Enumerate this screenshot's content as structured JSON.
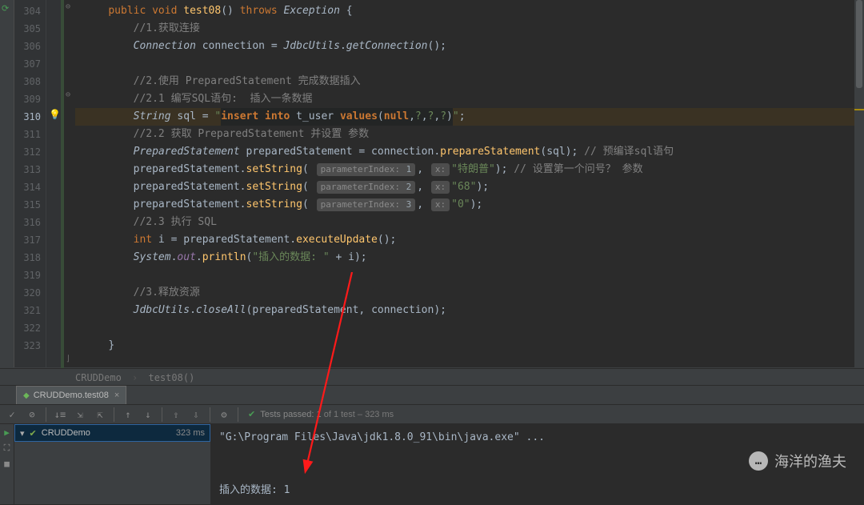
{
  "editor": {
    "first_line_number": 304,
    "highlighted_line": 310,
    "code_lines": [
      {
        "n": 304,
        "tokens": [
          [
            "kw",
            "public"
          ],
          [
            "p",
            " "
          ],
          [
            "kw",
            "void"
          ],
          [
            "p",
            " "
          ],
          [
            "method",
            "test08"
          ],
          [
            "p",
            "() "
          ],
          [
            "kw",
            "throws"
          ],
          [
            "p",
            " "
          ],
          [
            "cls",
            "Exception"
          ],
          [
            "p",
            " {"
          ]
        ],
        "indent": 1
      },
      {
        "n": 305,
        "tokens": [
          [
            "comment",
            "//1.获取连接"
          ]
        ],
        "indent": 2
      },
      {
        "n": 306,
        "tokens": [
          [
            "cls",
            "Connection"
          ],
          [
            "p",
            " connection = "
          ],
          [
            "cls",
            "JdbcUtils"
          ],
          [
            "p",
            "."
          ],
          [
            "cls",
            "getConnection"
          ],
          [
            "p",
            "();"
          ]
        ],
        "indent": 2
      },
      {
        "n": 307,
        "tokens": [],
        "indent": 2
      },
      {
        "n": 308,
        "tokens": [
          [
            "comment",
            "//2.使用 PreparedStatement 完成数据插入"
          ]
        ],
        "indent": 2
      },
      {
        "n": 309,
        "tokens": [
          [
            "comment",
            "//2.1 编写SQL语句:  插入一条数据"
          ]
        ],
        "indent": 2
      },
      {
        "n": 310,
        "tokens": [
          [
            "cls",
            "String"
          ],
          [
            "p",
            " sql = "
          ],
          [
            "str",
            "\""
          ],
          [
            "sql-kw",
            "insert"
          ],
          [
            "sql-tok",
            " "
          ],
          [
            "sql-kw",
            "into"
          ],
          [
            "sql-tok",
            " t_user "
          ],
          [
            "sql-kw",
            "values"
          ],
          [
            "sql-tok",
            "("
          ],
          [
            "sql-kw",
            "null"
          ],
          [
            "sql-tok",
            ","
          ],
          [
            "sql-q",
            "?"
          ],
          [
            "sql-tok",
            ","
          ],
          [
            "sql-q",
            "?"
          ],
          [
            "sql-tok",
            ","
          ],
          [
            "sql-q",
            "?"
          ],
          [
            "sql-tok",
            ")"
          ],
          [
            "str",
            "\""
          ],
          [
            "p",
            ";"
          ]
        ],
        "indent": 2
      },
      {
        "n": 311,
        "tokens": [
          [
            "comment",
            "//2.2 获取 PreparedStatement 并设置 参数"
          ]
        ],
        "indent": 2
      },
      {
        "n": 312,
        "tokens": [
          [
            "cls",
            "PreparedStatement"
          ],
          [
            "p",
            " preparedStatement = connection."
          ],
          [
            "method",
            "prepareStatement"
          ],
          [
            "p",
            "(sql); "
          ],
          [
            "comment",
            "// 预编译sql语句"
          ]
        ],
        "indent": 2
      },
      {
        "n": 313,
        "tokens": [
          [
            "p",
            "preparedStatement."
          ],
          [
            "method",
            "setString"
          ],
          [
            "p",
            "( "
          ],
          [
            "hint",
            "parameterIndex:",
            "1"
          ],
          [
            "p",
            ", "
          ],
          [
            "hint",
            "x:",
            ""
          ],
          [
            "str",
            "\"特朗普\""
          ],
          [
            "p",
            "); "
          ],
          [
            "comment",
            "// 设置第一个问号？ 参数"
          ]
        ],
        "indent": 2
      },
      {
        "n": 314,
        "tokens": [
          [
            "p",
            "preparedStatement."
          ],
          [
            "method",
            "setString"
          ],
          [
            "p",
            "( "
          ],
          [
            "hint",
            "parameterIndex:",
            "2"
          ],
          [
            "p",
            ", "
          ],
          [
            "hint",
            "x:",
            ""
          ],
          [
            "str",
            "\"68\""
          ],
          [
            "p",
            ");"
          ]
        ],
        "indent": 2
      },
      {
        "n": 315,
        "tokens": [
          [
            "p",
            "preparedStatement."
          ],
          [
            "method",
            "setString"
          ],
          [
            "p",
            "( "
          ],
          [
            "hint",
            "parameterIndex:",
            "3"
          ],
          [
            "p",
            ", "
          ],
          [
            "hint",
            "x:",
            ""
          ],
          [
            "str",
            "\"0\""
          ],
          [
            "p",
            ");"
          ]
        ],
        "indent": 2
      },
      {
        "n": 316,
        "tokens": [
          [
            "comment",
            "//2.3 执行 SQL"
          ]
        ],
        "indent": 2
      },
      {
        "n": 317,
        "tokens": [
          [
            "kw",
            "int"
          ],
          [
            "p",
            " i = preparedStatement."
          ],
          [
            "method",
            "executeUpdate"
          ],
          [
            "p",
            "();"
          ]
        ],
        "indent": 2
      },
      {
        "n": 318,
        "tokens": [
          [
            "cls",
            "System"
          ],
          [
            "p",
            "."
          ],
          [
            "static-i",
            "out"
          ],
          [
            "p",
            "."
          ],
          [
            "method",
            "println"
          ],
          [
            "p",
            "("
          ],
          [
            "str",
            "\"插入的数据: \""
          ],
          [
            "p",
            " + i);"
          ]
        ],
        "indent": 2
      },
      {
        "n": 319,
        "tokens": [],
        "indent": 2
      },
      {
        "n": 320,
        "tokens": [
          [
            "comment",
            "//3.释放资源"
          ]
        ],
        "indent": 2
      },
      {
        "n": 321,
        "tokens": [
          [
            "cls",
            "JdbcUtils"
          ],
          [
            "p",
            "."
          ],
          [
            "cls",
            "closeAll"
          ],
          [
            "p",
            "(preparedStatement, connection);"
          ]
        ],
        "indent": 2
      },
      {
        "n": 322,
        "tokens": [],
        "indent": 2
      },
      {
        "n": 323,
        "tokens": [
          [
            "p",
            "}"
          ]
        ],
        "indent": 1
      }
    ]
  },
  "breadcrumb": {
    "class": "CRUDDemo",
    "method": "test08()"
  },
  "run_tab": {
    "label": "CRUDDemo.test08"
  },
  "test_status": {
    "text": "Tests passed: 1",
    "suffix": " of 1 test – 323 ms"
  },
  "tree": {
    "root_label": "CRUDDemo",
    "root_time": "323 ms"
  },
  "console": {
    "cmd": "\"G:\\Program Files\\Java\\jdk1.8.0_91\\bin\\java.exe\" ...",
    "out": "插入的数据: 1"
  },
  "watermark": "海洋的渔夫"
}
